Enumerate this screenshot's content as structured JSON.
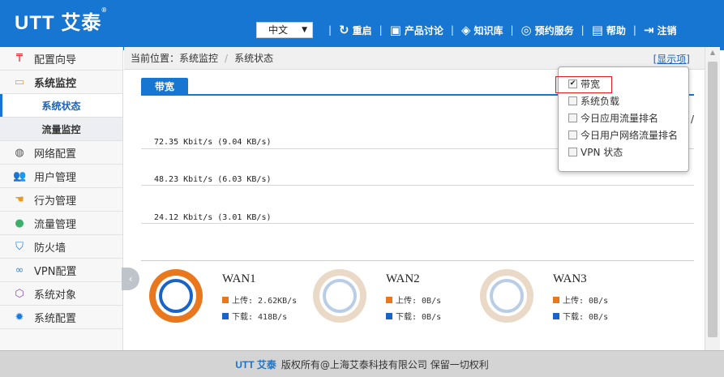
{
  "header": {
    "logo": "UTT 艾泰",
    "logo_mark": "®",
    "language": "中文",
    "nav": [
      {
        "label": "重启",
        "icon": "power-icon"
      },
      {
        "label": "产品讨论",
        "icon": "chat-icon"
      },
      {
        "label": "知识库",
        "icon": "layers-icon"
      },
      {
        "label": "预约服务",
        "icon": "service-icon"
      },
      {
        "label": "帮助",
        "icon": "help-book-icon"
      },
      {
        "label": "注销",
        "icon": "logout-icon"
      }
    ]
  },
  "sidebar": {
    "items": [
      {
        "label": "配置向导",
        "icon": "pin-icon"
      },
      {
        "label": "系统监控",
        "icon": "monitor-icon"
      },
      {
        "label": "系统状态"
      },
      {
        "label": "流量监控"
      },
      {
        "label": "网络配置",
        "icon": "globe-icon"
      },
      {
        "label": "用户管理",
        "icon": "users-icon"
      },
      {
        "label": "行为管理",
        "icon": "hand-icon"
      },
      {
        "label": "流量管理",
        "icon": "traffic-icon"
      },
      {
        "label": "防火墙",
        "icon": "shield-icon"
      },
      {
        "label": "VPN配置",
        "icon": "vpn-icon"
      },
      {
        "label": "系统对象",
        "icon": "cube-icon"
      },
      {
        "label": "系统配置",
        "icon": "gear-icon"
      }
    ]
  },
  "breadcrumb": {
    "prefix": "当前位置：",
    "level1": "系统监控",
    "level2": "系统状态",
    "show_items": "[显示项]"
  },
  "panel": {
    "tab": "带宽",
    "grid_labels": [
      "72.35 Kbit/s (9.04 KB/s)",
      "48.23 Kbit/s (6.03 KB/s)",
      "24.12 Kbit/s (3.01 KB/s)"
    ],
    "axis_mark": "/"
  },
  "wans": [
    {
      "name": "WAN1",
      "upload": "上传: 2.62KB/s",
      "download": "下载: 418B/s",
      "active": true
    },
    {
      "name": "WAN2",
      "upload": "上传: 0B/s",
      "download": "下载: 0B/s",
      "active": false
    },
    {
      "name": "WAN3",
      "upload": "上传: 0B/s",
      "download": "下载: 0B/s",
      "active": false
    }
  ],
  "dropdown": {
    "options": [
      {
        "label": "带宽",
        "checked": true
      },
      {
        "label": "系统负载",
        "checked": false
      },
      {
        "label": "今日应用流量排名",
        "checked": false
      },
      {
        "label": "今日用户网络流量排名",
        "checked": false
      },
      {
        "label": "VPN 状态",
        "checked": false
      }
    ]
  },
  "footer": {
    "logo": "UTT 艾泰",
    "text": "版权所有@上海艾泰科技有限公司 保留一切权利"
  },
  "colors": {
    "primary": "#1676d2",
    "upload": "#e8771e",
    "download": "#1a64c8",
    "inactive_ring": "#ead9c6",
    "inactive_core": "#b9cde6"
  }
}
